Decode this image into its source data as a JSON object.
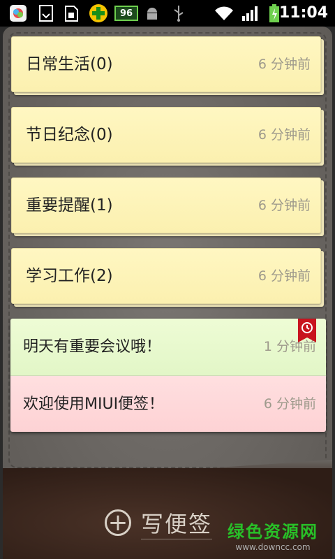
{
  "status_bar": {
    "icons": [
      "app-store-icon",
      "download-icon",
      "sd-card-icon",
      "security-plus-icon",
      "battery-level-badge-icon",
      "android-debug-icon",
      "usb-icon",
      "wifi-icon",
      "signal-icon",
      "battery-charging-icon"
    ],
    "badge_number": "96",
    "time": "11:04"
  },
  "folders": [
    {
      "title": "日常生活(0)",
      "time": "6 分钟前"
    },
    {
      "title": "节日纪念(0)",
      "time": "6 分钟前"
    },
    {
      "title": "重要提醒(1)",
      "time": "6 分钟前"
    },
    {
      "title": "学习工作(2)",
      "time": "6 分钟前"
    }
  ],
  "notes": [
    {
      "title": "明天有重要会议哦！",
      "time": "1 分钟前",
      "color": "#e6f8cb",
      "has_alarm": true
    },
    {
      "title": "欢迎使用MIUI便签！",
      "time": "6 分钟前",
      "color": "#fed6d8",
      "has_alarm": false
    }
  ],
  "bottom": {
    "new_note_label": "写便签",
    "icon": "plus-circle-icon"
  },
  "watermark": {
    "main": "绿色资源网",
    "sub": "www.downcc.com"
  },
  "colors": {
    "folder_yellow": "#fbf0af",
    "board": "#6e6a66",
    "leather": "#2e1d16",
    "alarm_red": "#c8141e"
  }
}
